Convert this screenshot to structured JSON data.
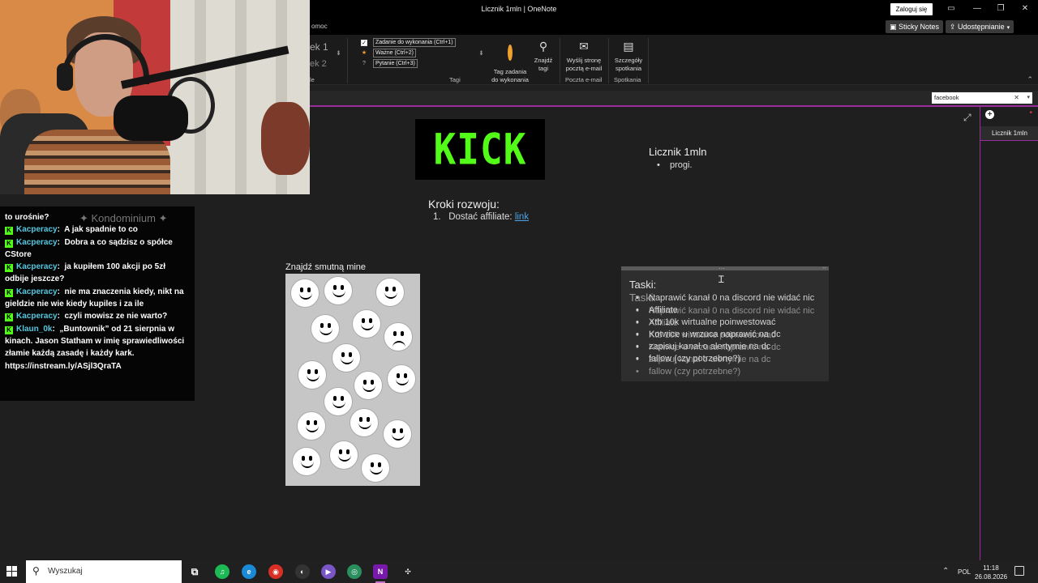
{
  "window": {
    "title": "Licznik 1mln  |  OneNote",
    "signin_label": "Zaloguj się"
  },
  "ribbon": {
    "menu_tail": "omoc",
    "sticky_notes": "Sticky Notes",
    "share": "Udostępnianie",
    "style_fragment_1": "ek 1",
    "style_fragment_2": "ek 2",
    "styles_group_tail": "le",
    "tags": [
      {
        "label": "Zadanie do wykonania (Ctrl+1)",
        "icon": "checkbox-icon"
      },
      {
        "label": "Ważne (Ctrl+2)",
        "icon": "star-icon"
      },
      {
        "label": "Pytanie (Ctrl+3)",
        "icon": "question-icon"
      }
    ],
    "tag_task_l1": "Tag zadania",
    "tag_task_l2": "do wykonania",
    "find_tags_l1": "Znajdź",
    "find_tags_l2": "tagi",
    "tags_group": "Tagi",
    "send_page_l1": "Wyślij stronę",
    "send_page_l2": "pocztą e-mail",
    "email_group": "Poczta e-mail",
    "meeting_l1": "Szczegóły",
    "meeting_l2": "spotkania",
    "meetings_group": "Spotkania"
  },
  "search": {
    "value": "facebook"
  },
  "page": {
    "title": "Licznik 1mln",
    "title_bullets": [
      "progi."
    ],
    "steps_heading": "Kroki rozwoju:",
    "steps": [
      {
        "num": "1.",
        "text": "Dostać affiliate: ",
        "link": "link"
      }
    ],
    "find_sad_label": "Znajdź smutną mine",
    "tasks_heading": "Taski:",
    "tasks_layer_a": [
      "Naprawić kanał 0 na discord nie widać nic",
      "Affiliate",
      "Xtb 10k wirtualne poinwestować",
      "Kotwice u wrzuca naprawić na dc",
      "zapisuj kanał o alertymie na dc",
      "fallow (czy potrzebne?)"
    ],
    "tasks_layer_b": [
      "Naprawić kanał 0 na discord nie widać nic",
      "Affiliate",
      "Xtb 10k wirtualne poinwestować",
      "Kotwice u wrzuca naprawić na dc",
      "zapisuj kanał o alertymie na dc",
      "fallow (czy potrzebne?)"
    ]
  },
  "kick_logo": "KICK",
  "pages_pane": {
    "items": [
      "Licznik 1mln"
    ]
  },
  "chat": {
    "background_text": "✦ Kondominium ✦",
    "messages": [
      {
        "user": "",
        "text": "to urośnie?"
      },
      {
        "user": "Kacperacy",
        "text": "A jak spadnie to co"
      },
      {
        "user": "Kacperacy",
        "text": "Dobra a co sądzisz o spółce CStore"
      },
      {
        "user": "Kacperacy",
        "text": "ja kupiłem 100 akcji po 5zł odbije jeszcze?"
      },
      {
        "user": "Kacperacy",
        "text": "nie ma znaczenia kiedy, nikt na gieldzie nie wie kiedy kupiles i za ile"
      },
      {
        "user": "Kacperacy",
        "text": "czyli mowisz ze nie warto?"
      },
      {
        "user": "Klaun_0k",
        "text": "„Buntownik” od 21 sierpnia w kinach. Jason Statham w imię sprawiedliwości złamie każdą zasadę i każdy kark. https://instream.ly/ASjl3QraTA"
      }
    ]
  },
  "taskbar": {
    "search_placeholder": "Wyszukaj",
    "lang": "POL",
    "time": "11:18",
    "date": "26.08.2026"
  },
  "colors": {
    "onenote_purple": "#9a2d9e",
    "kick_green": "#53fc18",
    "link_blue": "#4da3e6"
  }
}
